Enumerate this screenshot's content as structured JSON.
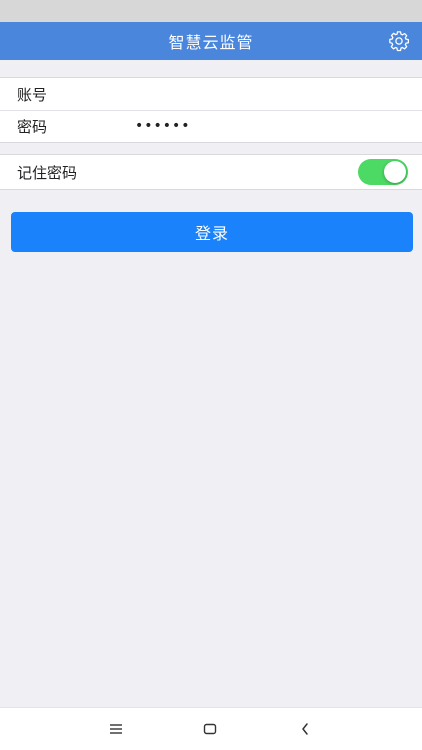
{
  "header": {
    "title": "智慧云监管",
    "settings_icon": "gear-icon"
  },
  "account_group": {
    "account_label": "账号",
    "account_value": "",
    "password_label": "密码",
    "password_value": "••••••"
  },
  "remember_group": {
    "remember_label": "记住密码",
    "remember_enabled": true
  },
  "login_button": {
    "label": "登录"
  },
  "bottom_nav": {
    "menu_icon": "menu-icon",
    "home_icon": "home-icon",
    "back_icon": "back-icon"
  },
  "colors": {
    "nav_bar": "#4a86dc",
    "login_button": "#1a82fb",
    "toggle_on": "#4cd964",
    "background": "#efeff4"
  }
}
